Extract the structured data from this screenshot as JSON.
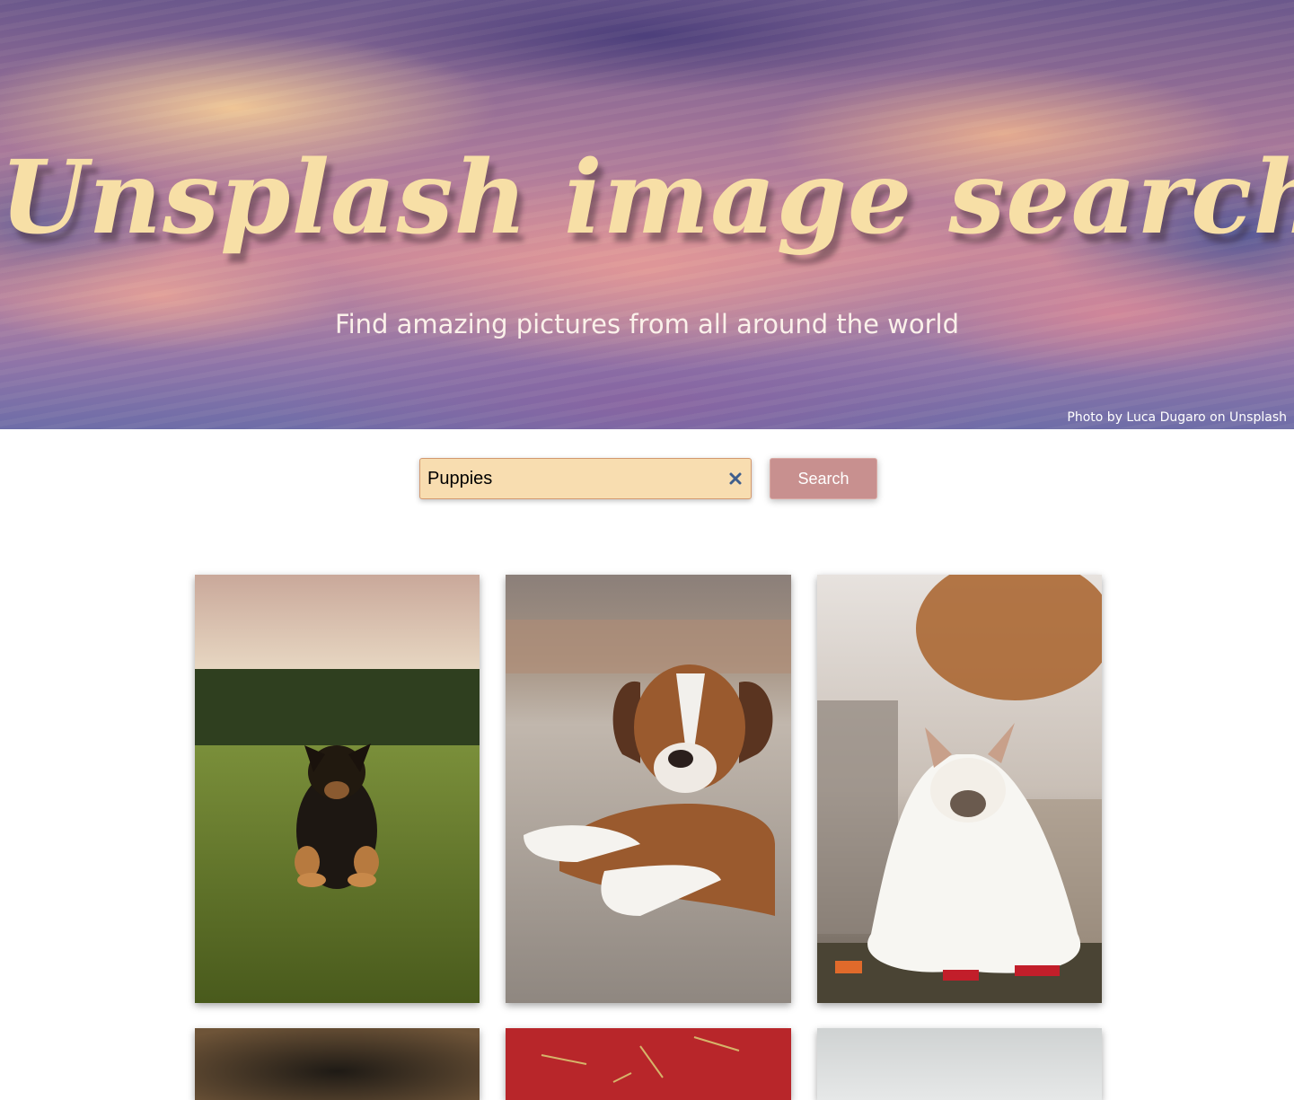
{
  "hero": {
    "title": "Unsplash image search",
    "subtitle": "Find amazing pictures from all around the world",
    "credit": "Photo by Luca Dugaro on Unsplash"
  },
  "search": {
    "value": "Puppies",
    "button_label": "Search"
  },
  "results": [
    {
      "subject": "german-shepherd-puppy-on-grass"
    },
    {
      "subject": "boxer-puppy-lying-on-ground"
    },
    {
      "subject": "french-bulldog-in-ghost-costume"
    },
    {
      "subject": "puppy-photo-dark"
    },
    {
      "subject": "puppy-photo-red"
    },
    {
      "subject": "puppy-photo-light"
    }
  ]
}
